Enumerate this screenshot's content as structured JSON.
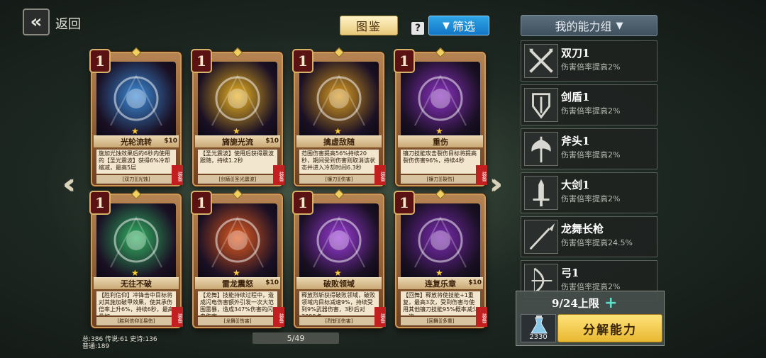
{
  "header": {
    "back_label": "返回",
    "codex_label": "图鉴",
    "help_symbol": "?",
    "filter_label": "筛选",
    "my_set_label": "我的能力组"
  },
  "cards": [
    {
      "cost": "1",
      "name": "光轮流转",
      "price": "$10",
      "desc": "施加光蚀效果后的6秒内使用的【圣光震波】获得6%冷却缩减，最高5层",
      "tags": "[双刀][光蚀]",
      "ribbon": "装备",
      "accent": "#3a8ad8"
    },
    {
      "cost": "1",
      "name": "旖旎光流",
      "price": "$10",
      "desc": "【圣光震波】使用后获得震波跟随，持续1.2秒",
      "tags": "[剑盾][圣光震波]",
      "ribbon": "装备",
      "accent": "#e8b020"
    },
    {
      "cost": "1",
      "name": "擒虚敌随",
      "price": "",
      "desc": "范围伤害提高56%持续20秒，期间受到伤害则取消该状态并进入冷却时间6.3秒",
      "tags": "[镰刀][伤害]",
      "ribbon": "装备",
      "accent": "#d89a20"
    },
    {
      "cost": "1",
      "name": "重伤",
      "price": "",
      "desc": "镰刀技能攻击裂伤目标将提高裂伤伤害96%，持续4秒",
      "tags": "[镰刀][裂伤]",
      "ribbon": "装备",
      "accent": "#8a30c0"
    },
    {
      "cost": "1",
      "name": "无往不破",
      "price": "",
      "desc": "【胜利信仰】冲锋击中目标将对其施加破甲效果，使其承伤倍率上升6%，持续6秒，最高叠加",
      "tags": "[胜利信仰][易伤]",
      "ribbon": "装备",
      "accent": "#30b060"
    },
    {
      "cost": "1",
      "name": "雷龙震怒",
      "price": "$10",
      "desc": "【龙舞】技能持续过程中，造成闪电伤害额外引发一次大范围雷暴，造成347%伤害的闪电伤害",
      "tags": "[龙舞][伤害]",
      "ribbon": "装备",
      "accent": "#e05a20"
    },
    {
      "cost": "1",
      "name": "破败领域",
      "price": "",
      "desc": "释放烈斩获得破败领域，破败领域内目标减速9%，持续受到9%武器伤害，3秒后对3000点",
      "tags": "[烈斩][伤害]",
      "ribbon": "装备",
      "accent": "#9a3ad8"
    },
    {
      "cost": "1",
      "name": "连复乐章",
      "price": "$10",
      "desc": "【回舞】释放将使技能+1重复，最高3次，受到伤害与使用其他镰刀技能95%概率减少一次",
      "tags": "[回舞][多重]",
      "ribbon": "装备",
      "accent": "#7a2ab0"
    }
  ],
  "stats": {
    "line1": "总:386 传说:61 史诗:136",
    "line2": "普通:189"
  },
  "pager": "5/49",
  "abilities": [
    {
      "name": "双刀1",
      "desc": "伤害倍率提高2%",
      "icon": "crossed-blades-icon"
    },
    {
      "name": "剑盾1",
      "desc": "伤害倍率提高2%",
      "icon": "sword-shield-icon"
    },
    {
      "name": "斧头1",
      "desc": "伤害倍率提高2%",
      "icon": "axe-icon"
    },
    {
      "name": "大剑1",
      "desc": "伤害倍率提高2%",
      "icon": "greatsword-icon"
    },
    {
      "name": "龙舞长枪",
      "desc": "伤害倍率提高24.5%",
      "icon": "spear-icon"
    },
    {
      "name": "弓1",
      "desc": "伤害倍率提高2%",
      "icon": "bow-icon"
    }
  ],
  "limit": {
    "text": "9/24上限",
    "resource_count": "2330",
    "decompose_label": "分解能力"
  },
  "colors": {
    "accent_gold": "#e8c979",
    "filter_blue": "#1e8ad8",
    "card_frame": "#b68452",
    "ribbon_red": "#c22020"
  }
}
